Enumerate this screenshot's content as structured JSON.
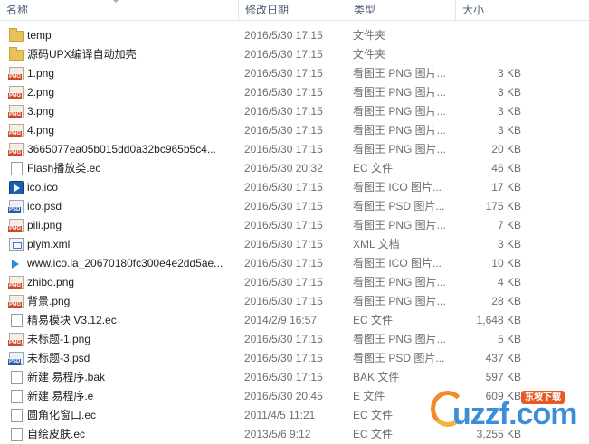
{
  "columns": {
    "name": "名称",
    "date": "修改日期",
    "type": "类型",
    "size": "大小"
  },
  "files": [
    {
      "icon": "folder",
      "name": "temp",
      "date": "2016/5/30 17:15",
      "type": "文件夹",
      "size": ""
    },
    {
      "icon": "folder",
      "name": "源码UPX编译自动加壳",
      "date": "2016/5/30 17:15",
      "type": "文件夹",
      "size": ""
    },
    {
      "icon": "png",
      "name": "1.png",
      "date": "2016/5/30 17:15",
      "type": "看图王 PNG 图片...",
      "size": "3 KB"
    },
    {
      "icon": "png",
      "name": "2.png",
      "date": "2016/5/30 17:15",
      "type": "看图王 PNG 图片...",
      "size": "3 KB"
    },
    {
      "icon": "png",
      "name": "3.png",
      "date": "2016/5/30 17:15",
      "type": "看图王 PNG 图片...",
      "size": "3 KB"
    },
    {
      "icon": "png",
      "name": "4.png",
      "date": "2016/5/30 17:15",
      "type": "看图王 PNG 图片...",
      "size": "3 KB"
    },
    {
      "icon": "png",
      "name": "3665077ea05b015dd0a32bc965b5c4...",
      "date": "2016/5/30 17:15",
      "type": "看图王 PNG 图片...",
      "size": "20 KB"
    },
    {
      "icon": "doc",
      "name": "Flash播放类.ec",
      "date": "2016/5/30 20:32",
      "type": "EC 文件",
      "size": "46 KB"
    },
    {
      "icon": "ico",
      "name": "ico.ico",
      "date": "2016/5/30 17:15",
      "type": "看图王 ICO 图片...",
      "size": "17 KB"
    },
    {
      "icon": "psd",
      "name": "ico.psd",
      "date": "2016/5/30 17:15",
      "type": "看图王 PSD 图片...",
      "size": "175 KB"
    },
    {
      "icon": "png",
      "name": "pili.png",
      "date": "2016/5/30 17:15",
      "type": "看图王 PNG 图片...",
      "size": "7 KB"
    },
    {
      "icon": "xml",
      "name": "plym.xml",
      "date": "2016/5/30 17:15",
      "type": "XML 文档",
      "size": "3 KB"
    },
    {
      "icon": "ico2",
      "name": "www.ico.la_20670180fc300e4e2dd5ae...",
      "date": "2016/5/30 17:15",
      "type": "看图王 ICO 图片...",
      "size": "10 KB"
    },
    {
      "icon": "png",
      "name": "zhibo.png",
      "date": "2016/5/30 17:15",
      "type": "看图王 PNG 图片...",
      "size": "4 KB"
    },
    {
      "icon": "png",
      "name": "背景.png",
      "date": "2016/5/30 17:15",
      "type": "看图王 PNG 图片...",
      "size": "28 KB"
    },
    {
      "icon": "doc",
      "name": "精易模块 V3.12.ec",
      "date": "2014/2/9 16:57",
      "type": "EC 文件",
      "size": "1,648 KB"
    },
    {
      "icon": "png",
      "name": "未标题-1.png",
      "date": "2016/5/30 17:15",
      "type": "看图王 PNG 图片...",
      "size": "5 KB"
    },
    {
      "icon": "psd",
      "name": "未标题-3.psd",
      "date": "2016/5/30 17:15",
      "type": "看图王 PSD 图片...",
      "size": "437 KB"
    },
    {
      "icon": "doc",
      "name": "新建 易程序.bak",
      "date": "2016/5/30 17:15",
      "type": "BAK 文件",
      "size": "597 KB"
    },
    {
      "icon": "doc",
      "name": "新建 易程序.e",
      "date": "2016/5/30 20:45",
      "type": "E 文件",
      "size": "609 KB"
    },
    {
      "icon": "doc",
      "name": "圆角化窗口.ec",
      "date": "2011/4/5 11:21",
      "type": "EC 文件",
      "size": ""
    },
    {
      "icon": "doc",
      "name": "自绘皮肤.ec",
      "date": "2013/5/6 9:12",
      "type": "EC 文件",
      "size": "3,255 KB"
    }
  ],
  "watermark": {
    "logo": "uzzf.com",
    "badge": "东坡下载"
  },
  "colors": {
    "header_text": "#4c607a",
    "secondary_text": "#6d6d6d",
    "folder": "#e8c158"
  }
}
